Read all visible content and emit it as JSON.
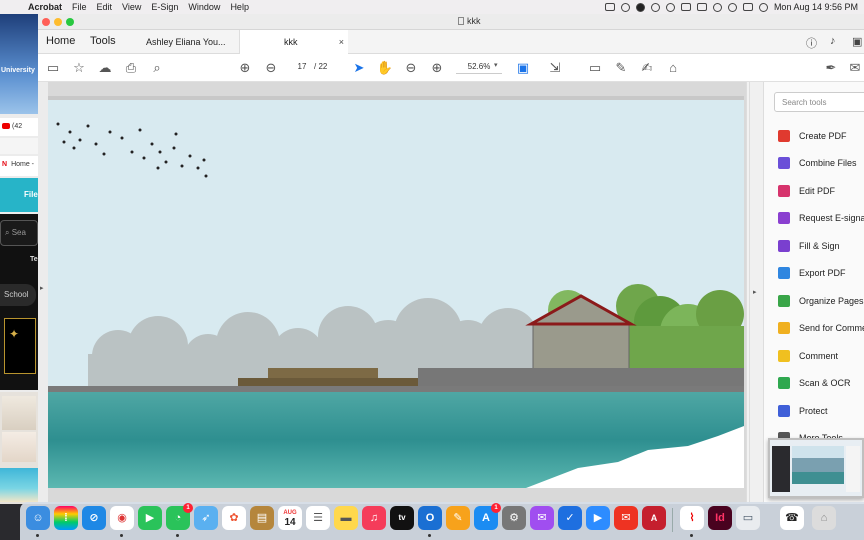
{
  "menubar": {
    "app": "Acrobat",
    "items": [
      "File",
      "Edit",
      "View",
      "E-Sign",
      "Window",
      "Help"
    ],
    "datetime": "Mon Aug 14  9:56 PM"
  },
  "background": {
    "university": "University",
    "yt_count": "(42",
    "home_crumb": "Home -",
    "file_tab": "File",
    "search": "Sea",
    "te": "Te",
    "school": "School"
  },
  "window": {
    "title": "kkk"
  },
  "tabs": {
    "home": "Home",
    "tools": "Tools",
    "doc1": "Ashley Eliana You...",
    "doc2": "kkk",
    "close": "×"
  },
  "toolbar": {
    "page_current": "17",
    "page_total": "/ 22",
    "zoom": "52.6%"
  },
  "tools_pane": {
    "search_placeholder": "Search tools",
    "items": [
      {
        "label": "Create PDF",
        "color": "#e03a2f"
      },
      {
        "label": "Combine Files",
        "color": "#6a4fd8"
      },
      {
        "label": "Edit PDF",
        "color": "#d6336c"
      },
      {
        "label": "Request E-signa",
        "color": "#8a3fd0"
      },
      {
        "label": "Fill & Sign",
        "color": "#7a3fcf"
      },
      {
        "label": "Export PDF",
        "color": "#2f86e0"
      },
      {
        "label": "Organize Pages",
        "color": "#39a548"
      },
      {
        "label": "Send for Comme",
        "color": "#f0b020"
      },
      {
        "label": "Comment",
        "color": "#f0c020"
      },
      {
        "label": "Scan & OCR",
        "color": "#2fa84f"
      },
      {
        "label": "Protect",
        "color": "#3f5fd8"
      },
      {
        "label": "More Tools",
        "color": "#555555"
      }
    ]
  },
  "dock": {
    "calendar_month": "AUG",
    "calendar_day": "14",
    "messages_badge": "1",
    "appstore_badge": "1",
    "appletv": "tv"
  }
}
